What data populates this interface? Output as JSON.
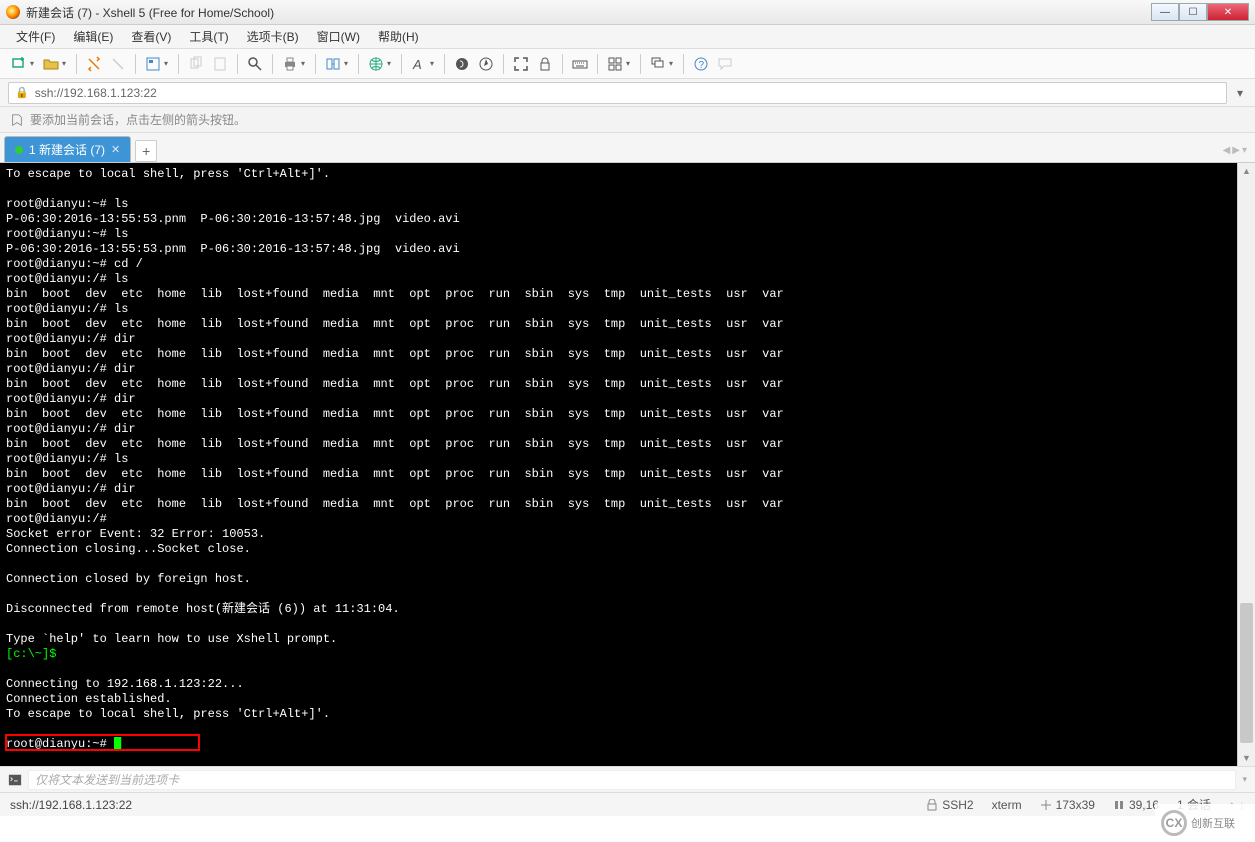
{
  "window": {
    "title": "新建会话 (7) - Xshell 5 (Free for Home/School)"
  },
  "menu": {
    "file": "文件(F)",
    "edit": "编辑(E)",
    "view": "查看(V)",
    "tools": "工具(T)",
    "tabs": "选项卡(B)",
    "window": "窗口(W)",
    "help": "帮助(H)"
  },
  "address": {
    "url": "ssh://192.168.1.123:22"
  },
  "hint": {
    "text": "要添加当前会话，点击左侧的箭头按钮。"
  },
  "tab": {
    "label": "1 新建会话 (7)"
  },
  "terminal_pre": "To escape to local shell, press 'Ctrl+Alt+]'.\n\nroot@dianyu:~# ls\nP-06:30:2016-13:55:53.pnm  P-06:30:2016-13:57:48.jpg  video.avi\nroot@dianyu:~# ls\nP-06:30:2016-13:55:53.pnm  P-06:30:2016-13:57:48.jpg  video.avi\nroot@dianyu:~# cd /\nroot@dianyu:/# ls\nbin  boot  dev  etc  home  lib  lost+found  media  mnt  opt  proc  run  sbin  sys  tmp  unit_tests  usr  var\nroot@dianyu:/# ls\nbin  boot  dev  etc  home  lib  lost+found  media  mnt  opt  proc  run  sbin  sys  tmp  unit_tests  usr  var\nroot@dianyu:/# dir\nbin  boot  dev  etc  home  lib  lost+found  media  mnt  opt  proc  run  sbin  sys  tmp  unit_tests  usr  var\nroot@dianyu:/# dir\nbin  boot  dev  etc  home  lib  lost+found  media  mnt  opt  proc  run  sbin  sys  tmp  unit_tests  usr  var\nroot@dianyu:/# dir\nbin  boot  dev  etc  home  lib  lost+found  media  mnt  opt  proc  run  sbin  sys  tmp  unit_tests  usr  var\nroot@dianyu:/# dir\nbin  boot  dev  etc  home  lib  lost+found  media  mnt  opt  proc  run  sbin  sys  tmp  unit_tests  usr  var\nroot@dianyu:/# ls\nbin  boot  dev  etc  home  lib  lost+found  media  mnt  opt  proc  run  sbin  sys  tmp  unit_tests  usr  var\nroot@dianyu:/# dir\nbin  boot  dev  etc  home  lib  lost+found  media  mnt  opt  proc  run  sbin  sys  tmp  unit_tests  usr  var\nroot@dianyu:/#\nSocket error Event: 32 Error: 10053.\nConnection closing...Socket close.\n\nConnection closed by foreign host.\n\nDisconnected from remote host(新建会话 (6)) at 11:31:04.\n\nType `help' to learn how to use Xshell prompt.",
  "terminal_prompt1": "[c:\\~]$",
  "terminal_post": "\nConnecting to 192.168.1.123:22...\nConnection established.\nTo escape to local shell, press 'Ctrl+Alt+]'.\n",
  "terminal_prompt2": "root@dianyu:~# ",
  "sendbar": {
    "placeholder": "仅将文本发送到当前选项卡"
  },
  "status": {
    "addr": "ssh://192.168.1.123:22",
    "proto": "SSH2",
    "term": "xterm",
    "size": "173x39",
    "pos": "39,16",
    "sess": "1 会话"
  },
  "watermark": {
    "text": "创新互联"
  }
}
